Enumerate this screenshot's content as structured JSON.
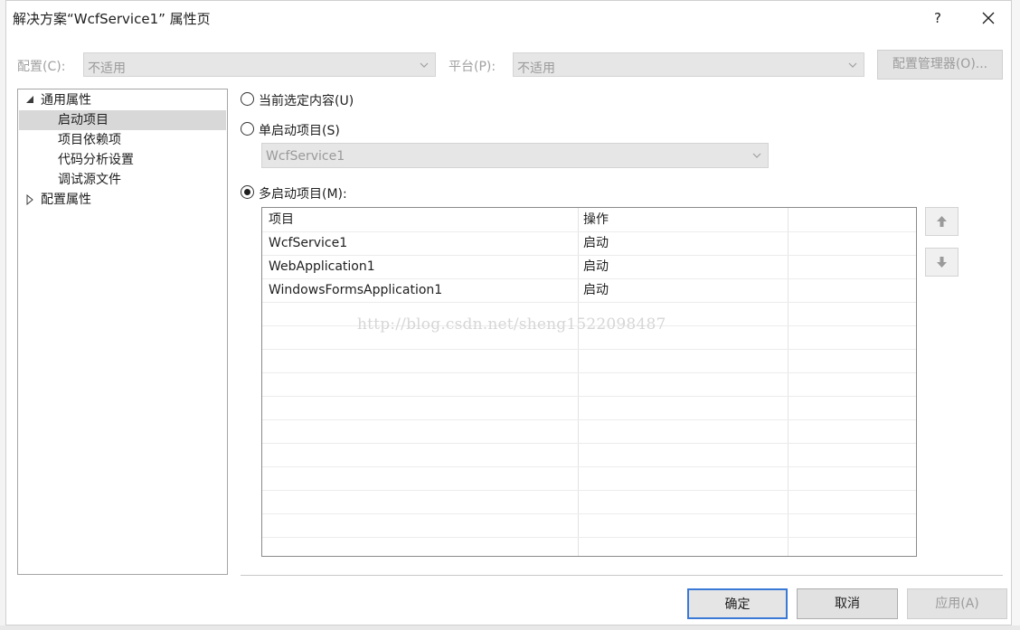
{
  "dialog": {
    "title": "解决方案“WcfService1” 属性页",
    "help_label": "?"
  },
  "config": {
    "config_label": "配置(C):",
    "config_value": "不适用",
    "platform_label": "平台(P):",
    "platform_value": "不适用",
    "manager_button": "配置管理器(O)..."
  },
  "tree": {
    "items": [
      {
        "label": "通用属性",
        "expanded": true
      },
      {
        "label": "启动项目",
        "selected": true
      },
      {
        "label": "项目依赖项"
      },
      {
        "label": "代码分析设置"
      },
      {
        "label": "调试源文件"
      },
      {
        "label": "配置属性",
        "expanded": false
      }
    ]
  },
  "startup": {
    "current_selection_label": "当前选定内容(U)",
    "single_label": "单启动项目(S)",
    "single_value": "WcfService1",
    "multiple_label": "多启动项目(M):",
    "selected_option": "multiple"
  },
  "grid": {
    "headers": [
      "项目",
      "操作"
    ],
    "rows": [
      [
        "WcfService1",
        "启动"
      ],
      [
        "WebApplication1",
        "启动"
      ],
      [
        "WindowsFormsApplication1",
        "启动"
      ]
    ]
  },
  "watermark": "http://blog.csdn.net/sheng1522098487",
  "buttons": {
    "ok": "确定",
    "cancel": "取消",
    "apply": "应用(A)"
  },
  "colors": {
    "accent": "#3b79d6",
    "disabled_bg": "#e6e6e6",
    "selection_bg": "#d8d8d8"
  }
}
